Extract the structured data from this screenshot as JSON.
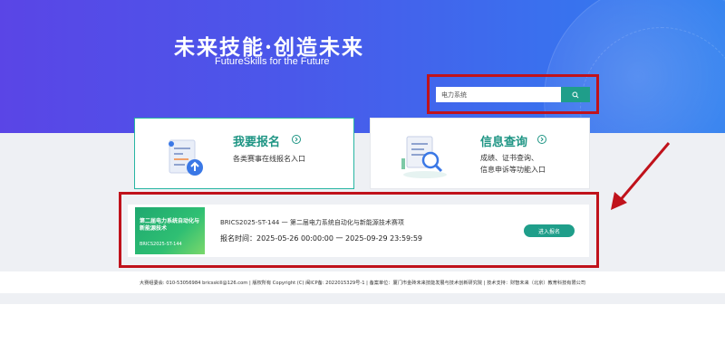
{
  "hero": {
    "title": "未来技能·创造未来",
    "subtitle": "FutureSkills  for the Future"
  },
  "search": {
    "value": "电力系统",
    "icon": "search-icon"
  },
  "cards": {
    "register": {
      "title": "我要报名",
      "desc": "各类赛事在线报名入口",
      "icon": "registration-form-icon"
    },
    "info": {
      "title": "信息查询",
      "desc_line1": "成绩、证书查询、",
      "desc_line2": "信息申诉等功能入口",
      "icon": "document-search-icon"
    }
  },
  "competition": {
    "thumb_title": "第二届电力系统自动化与新能源技术",
    "thumb_code": "BRICS2025-ST-144",
    "name": "BRICS2025-ST-144 一 第二届电力系统自动化与新能源技术赛项",
    "time": "报名时间：2025-05-26 00:00:00 一 2025-09-29 23:59:59",
    "button": "进入报名"
  },
  "footer": {
    "text": "大赛组委会: 010-53056984 bricsskill@126.com  |  版权所有 Copyright (C) 闽ICP备: 2022015329号-1  |  备案单位：厦门市金砖未来技能发展与技术创新研究院  |  技术支持：财智未来（北京）教育科技有限公司"
  },
  "colors": {
    "accent": "#1f9e8a",
    "highlight": "#c0121b",
    "hero_start": "#5a45e6",
    "hero_end": "#2f7fef"
  }
}
